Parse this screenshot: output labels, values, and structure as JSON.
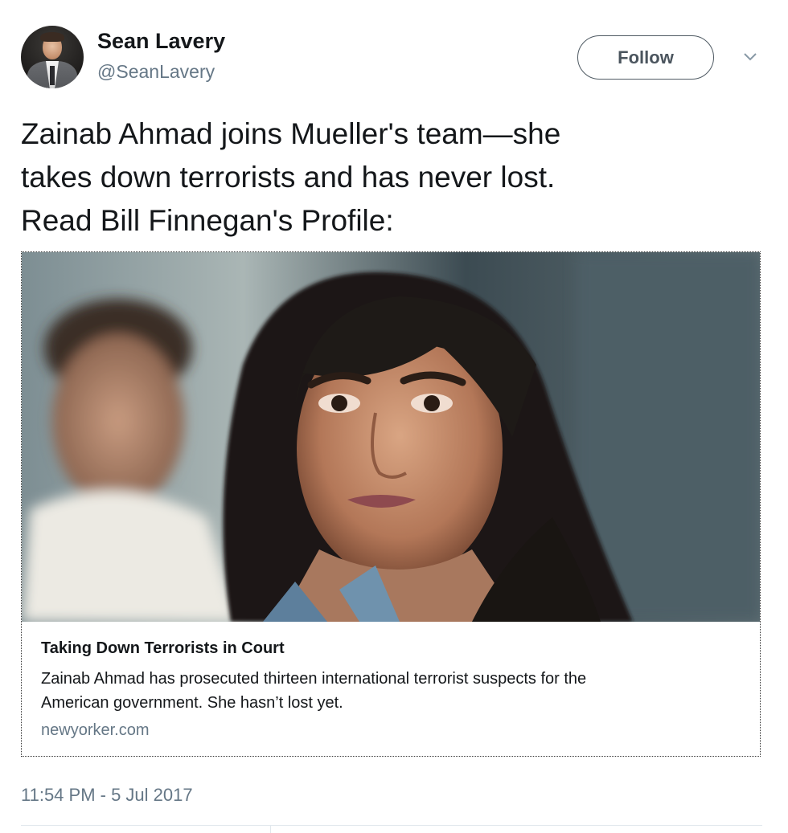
{
  "author": {
    "name": "Sean Lavery",
    "handle": "@SeanLavery"
  },
  "follow_button": {
    "label": "Follow"
  },
  "icons": {
    "more": "chevron-down-icon",
    "avatar": "avatar-photo"
  },
  "tweet": {
    "lines": [
      "Zainab Ahmad joins Mueller's team—she",
      "takes down terrorists and has never lost.",
      "Read Bill Finnegan's Profile:"
    ],
    "timestamp": "11:54 PM - 5 Jul 2017"
  },
  "card": {
    "title": "Taking Down Terrorists in Court",
    "description_lines": [
      "Zainab Ahmad has prosecuted thirteen international terrorist suspects for the",
      "American government. She hasn’t lost yet."
    ],
    "domain": "newyorker.com"
  },
  "colors": {
    "text_primary": "#14171a",
    "text_secondary": "#657786",
    "border": "#e1e8ed"
  }
}
